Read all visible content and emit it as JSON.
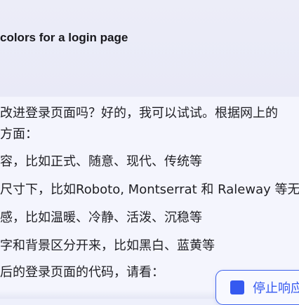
{
  "conversation": {
    "user_query": "colors for a login page",
    "answer_lines": [
      "改进登录页面吗？好的，我可以试试。根据网上的",
      "方面：",
      "容，比如正式、随意、现代、传统等",
      "尺寸下，比如Roboto, Montserrat 和 Raleway 等无",
      "感，比如温暖、冷静、活泼、沉稳等",
      "字和背景区分开来，比如黑白、蓝黄等",
      "后的登录页面的代码，请看："
    ]
  },
  "controls": {
    "stop_label": "停止响应",
    "stop_icon": "stop-square-icon",
    "accent_color": "#3559f0"
  }
}
